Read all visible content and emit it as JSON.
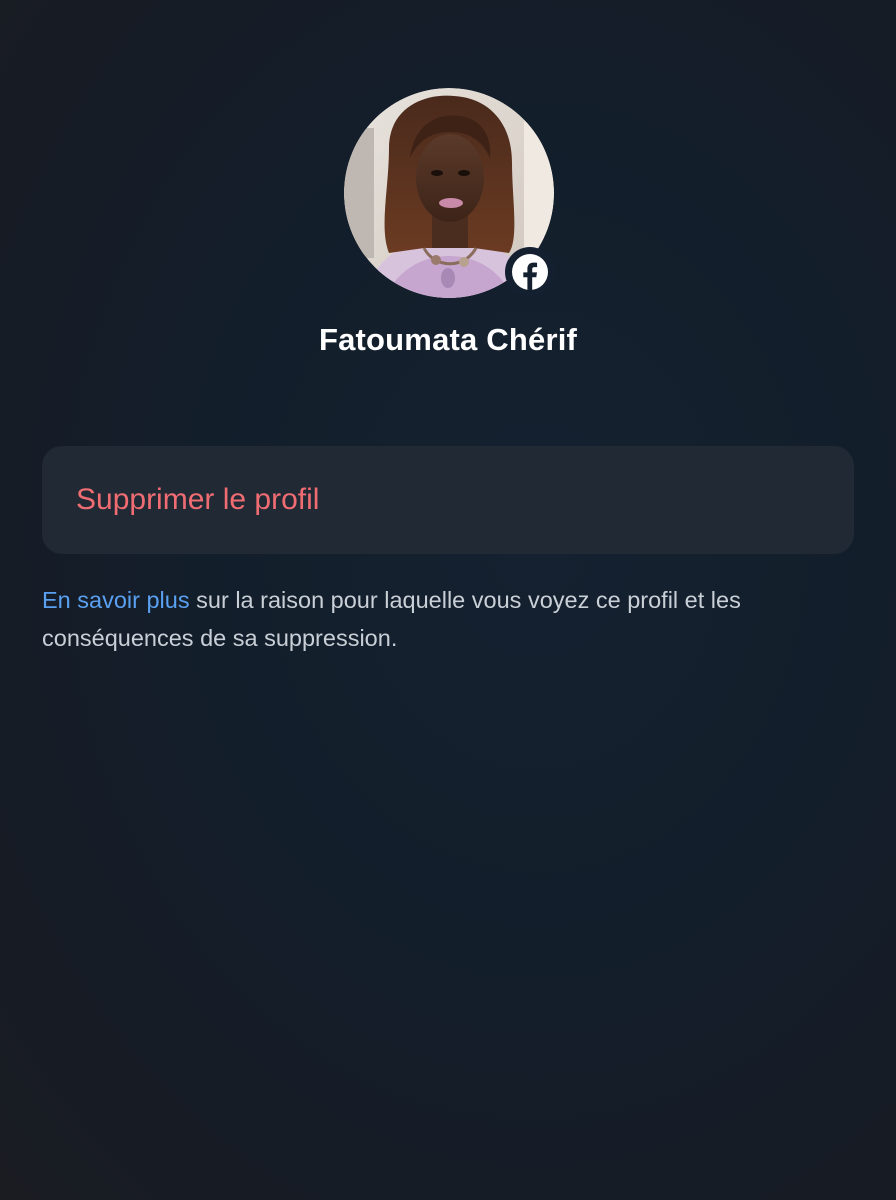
{
  "profile": {
    "name": "Fatoumata Chérif",
    "avatar_icon": "person-photo",
    "badge_icon": "facebook-icon"
  },
  "actions": {
    "delete_profile_label": "Supprimer le profil"
  },
  "info": {
    "link_text": "En savoir plus",
    "text": " sur la raison pour laquelle vous voyez ce profil et les conséquences de sa suppression."
  },
  "colors": {
    "background": "#131e2b",
    "card": "#212a34",
    "danger": "#f06c73",
    "link": "#5aa0f0",
    "body_text": "#c9cfd6"
  }
}
